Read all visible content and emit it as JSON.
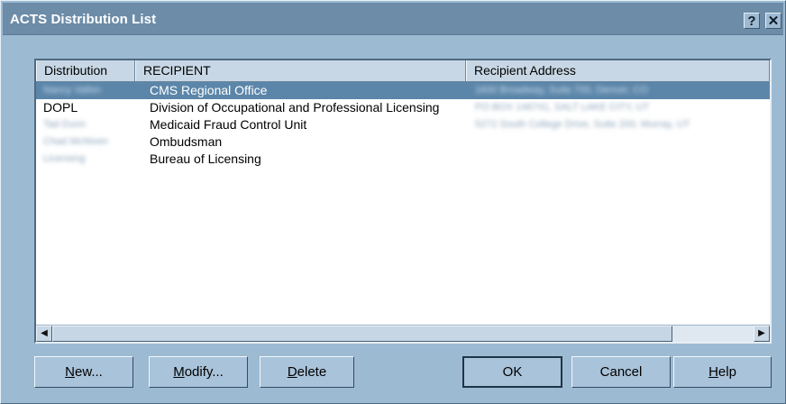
{
  "window": {
    "title": "ACTS Distribution List",
    "help_glyph": "?",
    "close_glyph": "✕"
  },
  "list": {
    "columns": [
      "Distribution",
      "RECIPIENT",
      "Recipient Address"
    ],
    "rows": [
      {
        "distribution": "Nancy Vallon",
        "recipient": "CMS Regional Office",
        "address": "1600 Broadway, Suite 700, Denver, CO",
        "selected": true
      },
      {
        "distribution": "DOPL",
        "recipient": "Division of Occupational and Professional Licensing",
        "address": "PO BOX 146741, SALT LAKE CITY, UT",
        "selected": false
      },
      {
        "distribution": "Tad Dunn",
        "recipient": "Medicaid Fraud Control Unit",
        "address": "5272 South College Drive, Suite 200, Murray, UT",
        "selected": false
      },
      {
        "distribution": "Chad McNiven",
        "recipient": "Ombudsman",
        "address": "",
        "selected": false
      },
      {
        "distribution": "Licensing",
        "recipient": "Bureau of Licensing",
        "address": "",
        "selected": false
      }
    ],
    "scroll_left_glyph": "◀",
    "scroll_right_glyph": "▶"
  },
  "buttons": {
    "new_prefix": "",
    "new_key": "N",
    "new_rest": "ew...",
    "modify_prefix": "",
    "modify_key": "M",
    "modify_rest": "odify...",
    "delete_prefix": "",
    "delete_key": "D",
    "delete_rest": "elete",
    "ok": "OK",
    "cancel": "Cancel",
    "help_prefix": "",
    "help_key": "H",
    "help_rest": "elp"
  }
}
